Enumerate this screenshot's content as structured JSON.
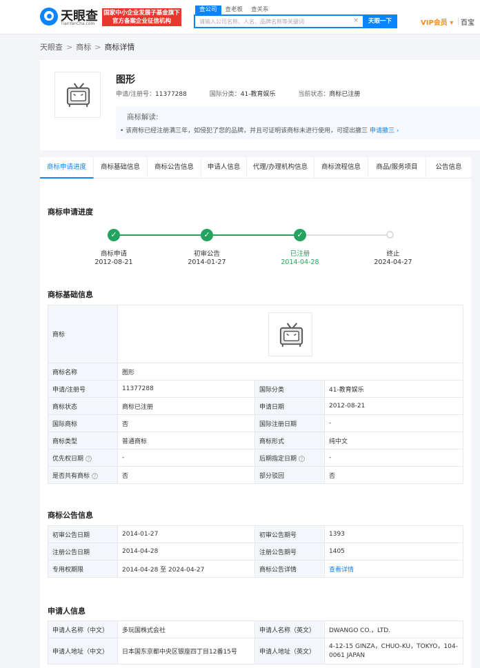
{
  "header": {
    "logo_name": "天眼查",
    "logo_sub": "TianYanCha.com",
    "badge_line1": "国家中小企业发展子基金旗下",
    "badge_line2": "官方备案企业征信机构",
    "search_tabs": [
      "查公司",
      "查老板",
      "查关系"
    ],
    "search_placeholder": "请输入公司名称、人名、品牌名称等关键词",
    "search_clear": "×",
    "search_button": "天眼一下",
    "vip": "VIP会员 ▾",
    "right_text": "百宝"
  },
  "breadcrumb": [
    "天眼查",
    "商标",
    "商标详情"
  ],
  "summary": {
    "title": "图形",
    "reg_no_label": "申请/注册号：",
    "reg_no": "11377288",
    "class_label": "国际分类：",
    "class_value": "41-教育娱乐",
    "status_label": "当前状态：",
    "status_value": "商标已注册",
    "interp_title": "商标解读:",
    "interp_text": "• 该商标已经注册满三年，如侵犯了您的品牌，并且可证明该商标未进行使用，可提出撤三",
    "interp_link": "申请撤三 ›"
  },
  "tabs": [
    "商标申请进度",
    "商标基础信息",
    "商标公告信息",
    "申请人信息",
    "代理/办理机构信息",
    "商标流程信息",
    "商品/服务项目",
    "公告信息"
  ],
  "progress": {
    "title": "商标申请进度",
    "steps": [
      {
        "name": "商标申请",
        "date": "2012-08-21",
        "done": true
      },
      {
        "name": "初审公告",
        "date": "2014-01-27",
        "done": true
      },
      {
        "name": "已注册",
        "date": "2014-04-28",
        "done": true
      },
      {
        "name": "终止",
        "date": "2024-04-27",
        "done": false
      }
    ]
  },
  "basic": {
    "title": "商标基础信息",
    "logo_label": "商标",
    "name_label": "商标名称",
    "name_value": "图形",
    "rows": [
      {
        "k1": "申请/注册号",
        "v1": "11377288",
        "k2": "国际分类",
        "v2": "41-教育娱乐"
      },
      {
        "k1": "商标状态",
        "v1": "商标已注册",
        "k2": "申请日期",
        "v2": "2012-08-21"
      },
      {
        "k1": "国际商标",
        "v1": "否",
        "k2": "国际注册日期",
        "v2": "-"
      },
      {
        "k1": "商标类型",
        "v1": "普通商标",
        "k2": "商标形式",
        "v2": "纯中文"
      },
      {
        "k1": "优先权日期",
        "v1": "-",
        "k2": "后期指定日期",
        "v2": "-"
      },
      {
        "k1": "是否共有商标",
        "v1": "否",
        "k2": "部分驳回",
        "v2": "否"
      }
    ],
    "help_icon": "?"
  },
  "notice": {
    "title": "商标公告信息",
    "rows": [
      {
        "k1": "初审公告日期",
        "v1": "2014-01-27",
        "k2": "初审公告期号",
        "v2": "1393"
      },
      {
        "k1": "注册公告日期",
        "v1": "2014-04-28",
        "k2": "注册公告期号",
        "v2": "1405"
      },
      {
        "k1": "专用权期限",
        "v1": "2014-04-28  至 2024-04-27",
        "k2": "商标公告详情",
        "v2": "查看详情"
      }
    ]
  },
  "applicant": {
    "title": "申请人信息",
    "rows": [
      {
        "k1": "申请人名称（中文）",
        "v1": "多玩国株式会社",
        "k2": "申请人名称（英文）",
        "v2": "DWANGO CO.，LTD."
      },
      {
        "k1": "申请人地址（中文）",
        "v1": "日本国东京都中央区银座四丁目12番15号",
        "k2": "申请人地址（英文）",
        "v2": "4-12-15 GINZA，CHUO-KU，TOKYO，104-0061 JAPAN"
      }
    ]
  },
  "colors": {
    "accent": "#0a84ff",
    "green": "#23a35d",
    "badge": "#e8372c",
    "vip": "#f08b1b"
  }
}
